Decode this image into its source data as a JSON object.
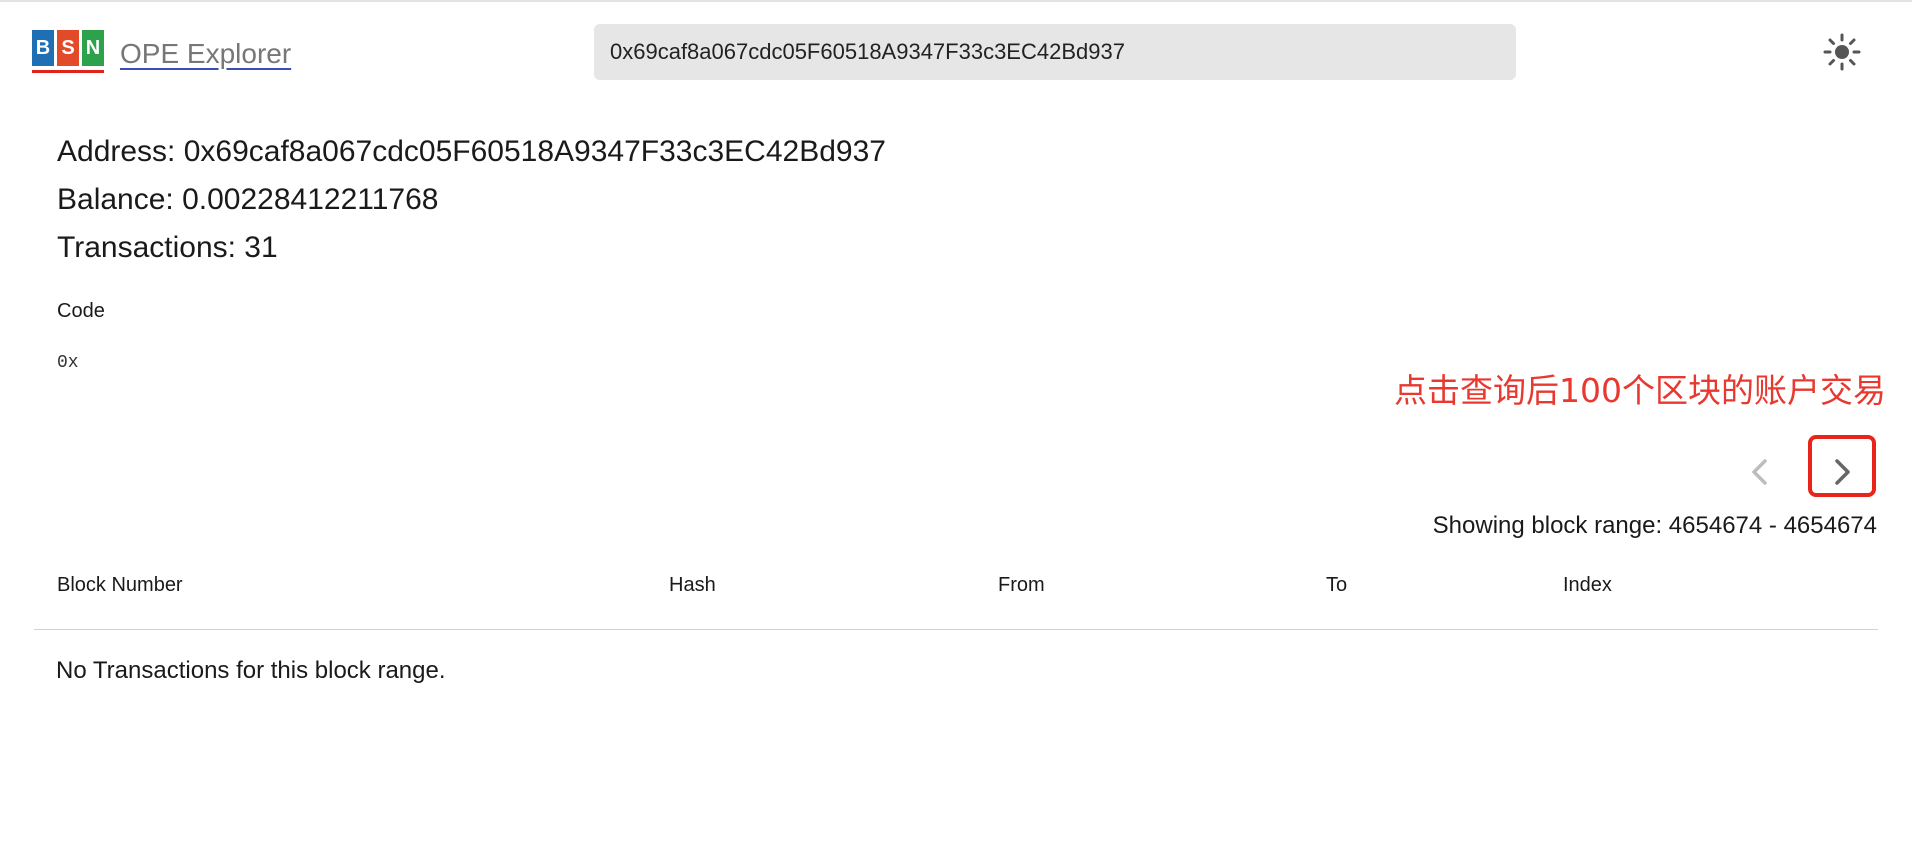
{
  "header": {
    "logo_letters": [
      "B",
      "S",
      "N"
    ],
    "logo_colors": [
      "#1f6fb5",
      "#e34a2a",
      "#2ea24a"
    ],
    "app_title": "OPE Explorer",
    "search_value": "0x69caf8a067cdc05F60518A9347F33c3EC42Bd937",
    "theme_icon": "sun-icon"
  },
  "summary": {
    "address": "Address: 0x69caf8a067cdc05F60518A9347F33c3EC42Bd937",
    "balance": "Balance: 0.00228412211768",
    "transactions": "Transactions: 31"
  },
  "code": {
    "label": "Code",
    "value": "0x"
  },
  "annotation": {
    "text": "点击查询后100个区块的账户交易",
    "color": "#e8382f"
  },
  "pagination": {
    "prev_icon": "chevron-left-icon",
    "next_icon": "chevron-right-icon",
    "range_text": "Showing block range: 4654674 - 4654674"
  },
  "table": {
    "columns": [
      "Block Number",
      "Hash",
      "From",
      "To",
      "Index"
    ],
    "empty_message": "No Transactions for this block range."
  }
}
